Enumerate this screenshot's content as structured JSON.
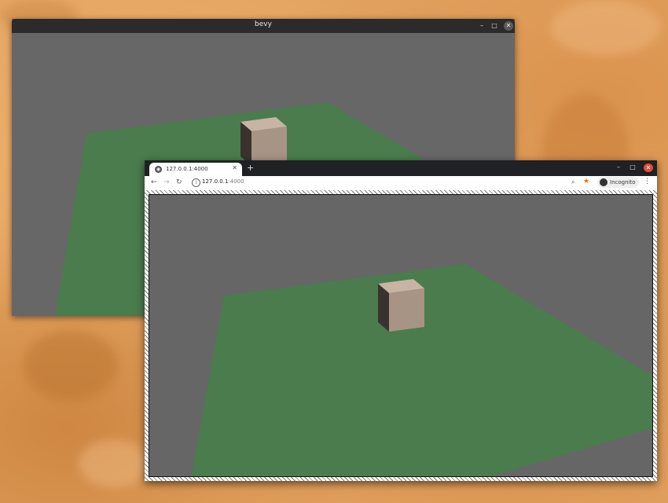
{
  "bevy_window": {
    "title": "bevy",
    "minimize_glyph": "–",
    "maximize_glyph": "□",
    "close_glyph": "✕"
  },
  "browser": {
    "tab": {
      "title": "127.0.0.1:4000",
      "close_glyph": "✕",
      "favicon": "globe-icon"
    },
    "new_tab_glyph": "+",
    "window_controls": {
      "minimize": "–",
      "maximize": "□",
      "close": "✕"
    },
    "toolbar": {
      "back_glyph": "←",
      "forward_glyph": "→",
      "reload_glyph": "↻",
      "info_glyph": "i",
      "url_host": "127.0.0.1",
      "url_port": ":4000",
      "zoom_glyph": "⌕",
      "star_glyph": "★",
      "incognito_label": "Incognito",
      "menu_glyph": "⋮"
    }
  },
  "colors": {
    "scene_background": "#676767",
    "ground_plane": "#4a7c4d",
    "cube_top": "#c7b4a3",
    "cube_front": "#a89484",
    "cube_side": "#3a332d",
    "titlebar": "#2b2b2b",
    "browser_chrome": "#202124"
  }
}
